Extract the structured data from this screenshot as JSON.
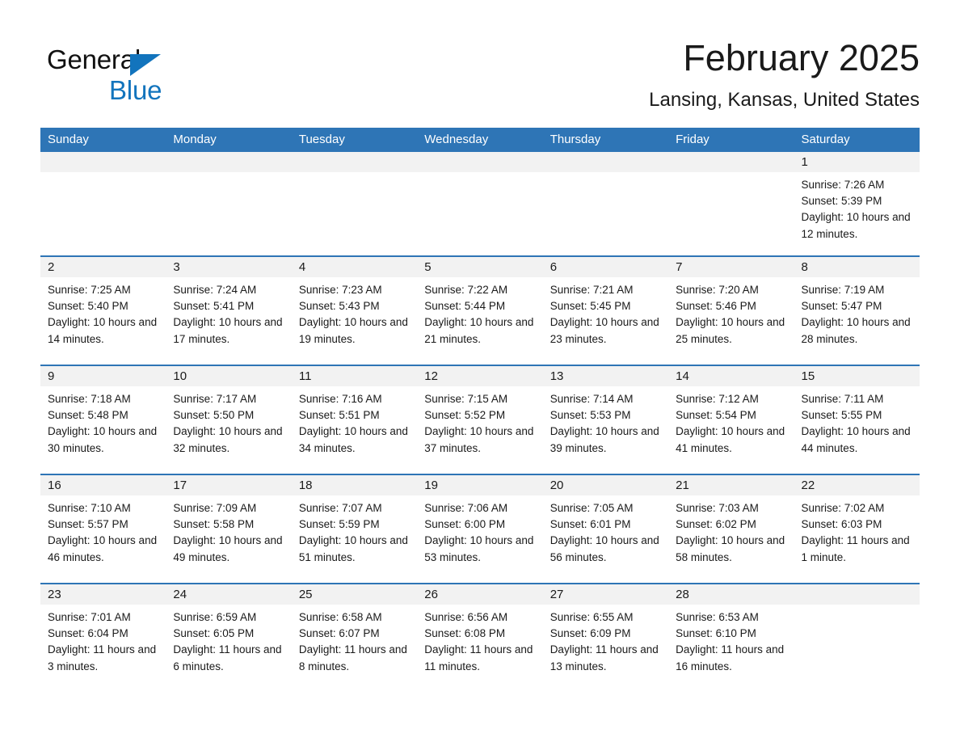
{
  "brand": {
    "name_part1": "General",
    "name_part2": "Blue",
    "accent_color": "#1274bd",
    "triangle_icon": "triangle-icon"
  },
  "header": {
    "title": "February 2025",
    "subtitle": "Lansing, Kansas, United States"
  },
  "calendar": {
    "header_color": "#2e75b6",
    "daynum_band_color": "#f2f2f2",
    "weekday_headers": [
      "Sunday",
      "Monday",
      "Tuesday",
      "Wednesday",
      "Thursday",
      "Friday",
      "Saturday"
    ],
    "weeks": [
      [
        {
          "day": "",
          "sunrise": "",
          "sunset": "",
          "daylight": "",
          "empty": true
        },
        {
          "day": "",
          "sunrise": "",
          "sunset": "",
          "daylight": "",
          "empty": true
        },
        {
          "day": "",
          "sunrise": "",
          "sunset": "",
          "daylight": "",
          "empty": true
        },
        {
          "day": "",
          "sunrise": "",
          "sunset": "",
          "daylight": "",
          "empty": true
        },
        {
          "day": "",
          "sunrise": "",
          "sunset": "",
          "daylight": "",
          "empty": true
        },
        {
          "day": "",
          "sunrise": "",
          "sunset": "",
          "daylight": "",
          "empty": true
        },
        {
          "day": "1",
          "sunrise": "Sunrise: 7:26 AM",
          "sunset": "Sunset: 5:39 PM",
          "daylight": "Daylight: 10 hours and 12 minutes.",
          "empty": false
        }
      ],
      [
        {
          "day": "2",
          "sunrise": "Sunrise: 7:25 AM",
          "sunset": "Sunset: 5:40 PM",
          "daylight": "Daylight: 10 hours and 14 minutes.",
          "empty": false
        },
        {
          "day": "3",
          "sunrise": "Sunrise: 7:24 AM",
          "sunset": "Sunset: 5:41 PM",
          "daylight": "Daylight: 10 hours and 17 minutes.",
          "empty": false
        },
        {
          "day": "4",
          "sunrise": "Sunrise: 7:23 AM",
          "sunset": "Sunset: 5:43 PM",
          "daylight": "Daylight: 10 hours and 19 minutes.",
          "empty": false
        },
        {
          "day": "5",
          "sunrise": "Sunrise: 7:22 AM",
          "sunset": "Sunset: 5:44 PM",
          "daylight": "Daylight: 10 hours and 21 minutes.",
          "empty": false
        },
        {
          "day": "6",
          "sunrise": "Sunrise: 7:21 AM",
          "sunset": "Sunset: 5:45 PM",
          "daylight": "Daylight: 10 hours and 23 minutes.",
          "empty": false
        },
        {
          "day": "7",
          "sunrise": "Sunrise: 7:20 AM",
          "sunset": "Sunset: 5:46 PM",
          "daylight": "Daylight: 10 hours and 25 minutes.",
          "empty": false
        },
        {
          "day": "8",
          "sunrise": "Sunrise: 7:19 AM",
          "sunset": "Sunset: 5:47 PM",
          "daylight": "Daylight: 10 hours and 28 minutes.",
          "empty": false
        }
      ],
      [
        {
          "day": "9",
          "sunrise": "Sunrise: 7:18 AM",
          "sunset": "Sunset: 5:48 PM",
          "daylight": "Daylight: 10 hours and 30 minutes.",
          "empty": false
        },
        {
          "day": "10",
          "sunrise": "Sunrise: 7:17 AM",
          "sunset": "Sunset: 5:50 PM",
          "daylight": "Daylight: 10 hours and 32 minutes.",
          "empty": false
        },
        {
          "day": "11",
          "sunrise": "Sunrise: 7:16 AM",
          "sunset": "Sunset: 5:51 PM",
          "daylight": "Daylight: 10 hours and 34 minutes.",
          "empty": false
        },
        {
          "day": "12",
          "sunrise": "Sunrise: 7:15 AM",
          "sunset": "Sunset: 5:52 PM",
          "daylight": "Daylight: 10 hours and 37 minutes.",
          "empty": false
        },
        {
          "day": "13",
          "sunrise": "Sunrise: 7:14 AM",
          "sunset": "Sunset: 5:53 PM",
          "daylight": "Daylight: 10 hours and 39 minutes.",
          "empty": false
        },
        {
          "day": "14",
          "sunrise": "Sunrise: 7:12 AM",
          "sunset": "Sunset: 5:54 PM",
          "daylight": "Daylight: 10 hours and 41 minutes.",
          "empty": false
        },
        {
          "day": "15",
          "sunrise": "Sunrise: 7:11 AM",
          "sunset": "Sunset: 5:55 PM",
          "daylight": "Daylight: 10 hours and 44 minutes.",
          "empty": false
        }
      ],
      [
        {
          "day": "16",
          "sunrise": "Sunrise: 7:10 AM",
          "sunset": "Sunset: 5:57 PM",
          "daylight": "Daylight: 10 hours and 46 minutes.",
          "empty": false
        },
        {
          "day": "17",
          "sunrise": "Sunrise: 7:09 AM",
          "sunset": "Sunset: 5:58 PM",
          "daylight": "Daylight: 10 hours and 49 minutes.",
          "empty": false
        },
        {
          "day": "18",
          "sunrise": "Sunrise: 7:07 AM",
          "sunset": "Sunset: 5:59 PM",
          "daylight": "Daylight: 10 hours and 51 minutes.",
          "empty": false
        },
        {
          "day": "19",
          "sunrise": "Sunrise: 7:06 AM",
          "sunset": "Sunset: 6:00 PM",
          "daylight": "Daylight: 10 hours and 53 minutes.",
          "empty": false
        },
        {
          "day": "20",
          "sunrise": "Sunrise: 7:05 AM",
          "sunset": "Sunset: 6:01 PM",
          "daylight": "Daylight: 10 hours and 56 minutes.",
          "empty": false
        },
        {
          "day": "21",
          "sunrise": "Sunrise: 7:03 AM",
          "sunset": "Sunset: 6:02 PM",
          "daylight": "Daylight: 10 hours and 58 minutes.",
          "empty": false
        },
        {
          "day": "22",
          "sunrise": "Sunrise: 7:02 AM",
          "sunset": "Sunset: 6:03 PM",
          "daylight": "Daylight: 11 hours and 1 minute.",
          "empty": false
        }
      ],
      [
        {
          "day": "23",
          "sunrise": "Sunrise: 7:01 AM",
          "sunset": "Sunset: 6:04 PM",
          "daylight": "Daylight: 11 hours and 3 minutes.",
          "empty": false
        },
        {
          "day": "24",
          "sunrise": "Sunrise: 6:59 AM",
          "sunset": "Sunset: 6:05 PM",
          "daylight": "Daylight: 11 hours and 6 minutes.",
          "empty": false
        },
        {
          "day": "25",
          "sunrise": "Sunrise: 6:58 AM",
          "sunset": "Sunset: 6:07 PM",
          "daylight": "Daylight: 11 hours and 8 minutes.",
          "empty": false
        },
        {
          "day": "26",
          "sunrise": "Sunrise: 6:56 AM",
          "sunset": "Sunset: 6:08 PM",
          "daylight": "Daylight: 11 hours and 11 minutes.",
          "empty": false
        },
        {
          "day": "27",
          "sunrise": "Sunrise: 6:55 AM",
          "sunset": "Sunset: 6:09 PM",
          "daylight": "Daylight: 11 hours and 13 minutes.",
          "empty": false
        },
        {
          "day": "28",
          "sunrise": "Sunrise: 6:53 AM",
          "sunset": "Sunset: 6:10 PM",
          "daylight": "Daylight: 11 hours and 16 minutes.",
          "empty": false
        },
        {
          "day": "",
          "sunrise": "",
          "sunset": "",
          "daylight": "",
          "empty": true
        }
      ]
    ]
  }
}
